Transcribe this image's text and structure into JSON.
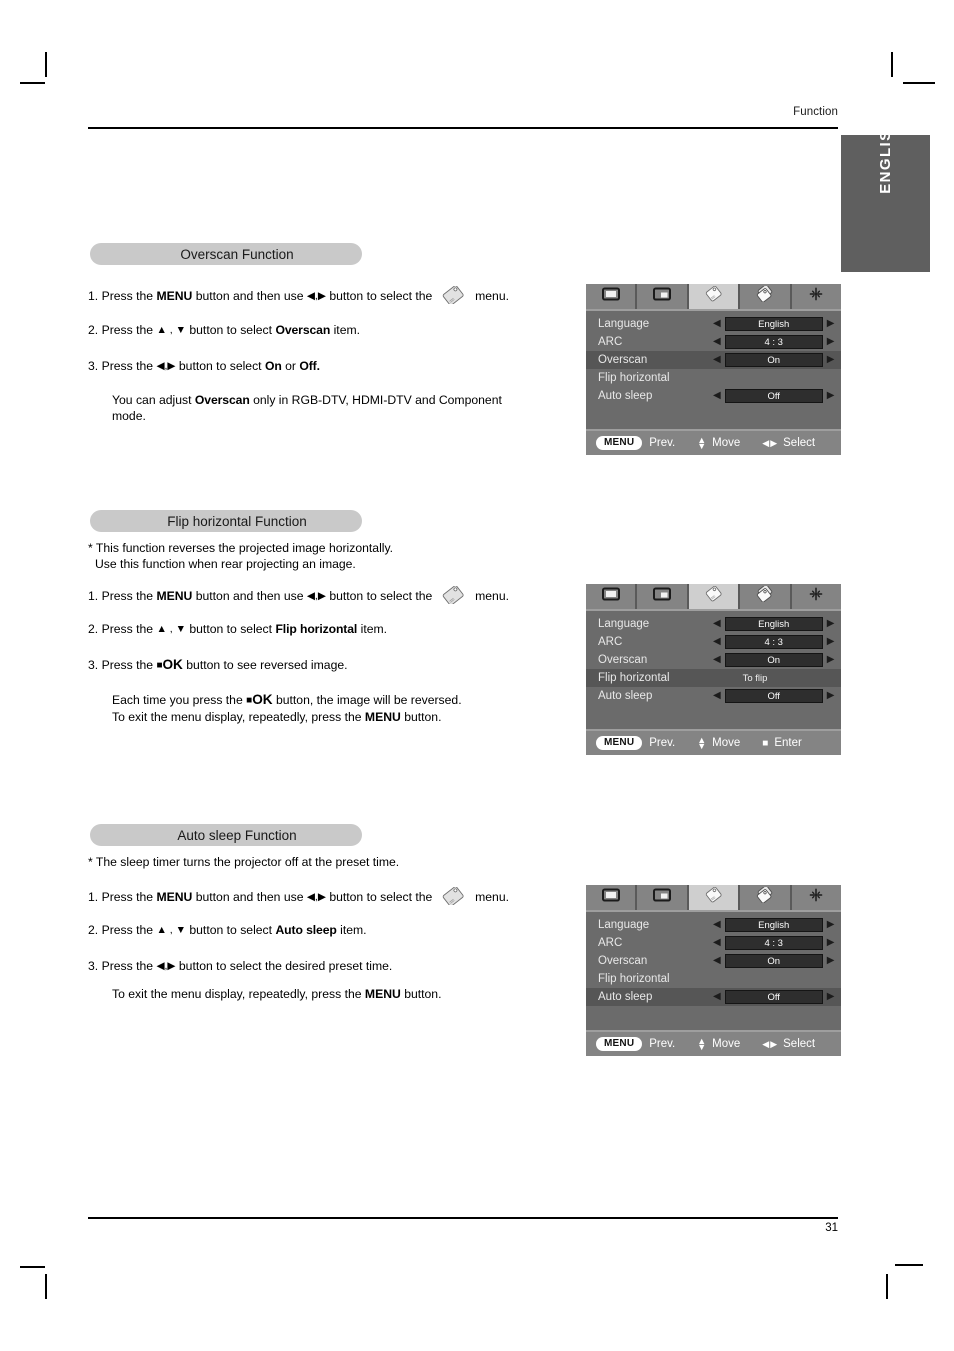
{
  "page": {
    "running_title": "Function",
    "language_tab": "ENGLISH",
    "page_number": "31"
  },
  "sections": [
    {
      "heading": "Overscan Function",
      "intro": [],
      "steps": [
        "1. Press the MENU button and then use ◀,▶ button to select the   menu.",
        "2. Press the ▲ , ▼ button to select Overscan item.",
        "3. Press the ◀,▶ button to select On or Off."
      ],
      "note": "You can adjust Overscan only in RGB-DTV, HDMI-DTV and Component mode."
    },
    {
      "heading": "Flip horizontal Function",
      "intro": [
        "* This function reverses the projected image horizontally.",
        "Use this function when rear projecting an image."
      ],
      "steps": [
        "1. Press the MENU button and then use ◀,▶ button to select the   menu.",
        "2. Press the ▲ , ▼ button to select Flip horizontal item.",
        "3. Press the ■OK button to see reversed image."
      ],
      "note": "Each time you press the ■OK button, the image will be reversed. To exit the menu display, repeatedly, press the MENU button."
    },
    {
      "heading": "Auto sleep Function",
      "intro": [
        "* The sleep timer turns the projector off at the preset time."
      ],
      "steps": [
        "1. Press the MENU button and then use ◀,▶ button to select the   menu.",
        "2. Press the ▲ , ▼ button to select Auto sleep item.",
        "3. Press the ◀,▶ button to select the desired preset time."
      ],
      "note": "To exit the menu display, repeatedly, press the MENU button."
    }
  ],
  "text": {
    "press_the": "Press the",
    "menu_bold": "MENU",
    "button_and_then_use": "button and then use",
    "button_to_select_the": "button to select the",
    "menu_word": "menu.",
    "button_to_select": "button to select",
    "item_word": "item.",
    "or_word": "or",
    "overscan_bold": "Overscan",
    "flip_horizontal_bold": "Flip horizontal",
    "auto_sleep_bold": "Auto sleep",
    "on_bold": "On",
    "off_bold": "Off.",
    "ok_bold": "OK",
    "num1": "1.",
    "num2": "2.",
    "num3": "3.",
    "left_right_arrows": "◀,▶",
    "up_down_arrows": "▲ , ▼",
    "square": "■",
    "note_overscan_a": "You can adjust",
    "note_overscan_b": "only in RGB-DTV, HDMI-DTV and Component",
    "note_overscan_c": "mode.",
    "flip_intro_1": "* This function reverses the projected image horizontally.",
    "flip_intro_2": "Use this function when rear projecting an image.",
    "flip_note_1a": "Each time you press the",
    "flip_note_1b": "button, the image will be reversed.",
    "flip_note_2a": "To exit the menu display, repeatedly, press the",
    "flip_note_2b": "button.",
    "flip_step3a": "button to see reversed image.",
    "sleep_intro_1": "* The sleep timer turns the projector off at the preset time.",
    "sleep_step3": "button to select the desired preset time.",
    "sleep_note_a": "To exit the menu display, repeatedly, press the",
    "sleep_note_b": "button."
  },
  "osd_panels": [
    {
      "id": "overscan",
      "tabs": [
        "screen-icon",
        "pip-icon",
        "tag-icon",
        "double-tag-icon",
        "adjust-icon"
      ],
      "active_tab_index": 2,
      "rows": [
        {
          "label": "Language",
          "value": "English",
          "type": "select",
          "selected": false
        },
        {
          "label": "ARC",
          "value": "4 : 3",
          "type": "select",
          "selected": false
        },
        {
          "label": "Overscan",
          "value": "On",
          "type": "select",
          "selected": true
        },
        {
          "label": "Flip horizontal",
          "value": "",
          "type": "none",
          "selected": false
        },
        {
          "label": "Auto sleep",
          "value": "Off",
          "type": "select",
          "selected": false
        }
      ],
      "footer": {
        "menu_chip": "MENU",
        "prev": "Prev.",
        "move": "Move",
        "action": "Select",
        "action_glyph": "◀▶"
      }
    },
    {
      "id": "flip-horizontal",
      "tabs": [
        "screen-icon",
        "pip-icon",
        "tag-icon",
        "double-tag-icon",
        "adjust-icon"
      ],
      "active_tab_index": 2,
      "rows": [
        {
          "label": "Language",
          "value": "English",
          "type": "select",
          "selected": false
        },
        {
          "label": "ARC",
          "value": "4 : 3",
          "type": "select",
          "selected": false
        },
        {
          "label": "Overscan",
          "value": "On",
          "type": "select",
          "selected": false
        },
        {
          "label": "Flip horizontal",
          "value": "To flip",
          "type": "note",
          "selected": true
        },
        {
          "label": "Auto sleep",
          "value": "Off",
          "type": "select",
          "selected": false
        }
      ],
      "footer": {
        "menu_chip": "MENU",
        "prev": "Prev.",
        "move": "Move",
        "action": "Enter",
        "action_glyph": "■"
      }
    },
    {
      "id": "auto-sleep",
      "tabs": [
        "screen-icon",
        "pip-icon",
        "tag-icon",
        "double-tag-icon",
        "adjust-icon"
      ],
      "active_tab_index": 2,
      "rows": [
        {
          "label": "Language",
          "value": "English",
          "type": "select",
          "selected": false
        },
        {
          "label": "ARC",
          "value": "4 : 3",
          "type": "select",
          "selected": false
        },
        {
          "label": "Overscan",
          "value": "On",
          "type": "select",
          "selected": false
        },
        {
          "label": "Flip horizontal",
          "value": "",
          "type": "none",
          "selected": false
        },
        {
          "label": "Auto sleep",
          "value": "Off",
          "type": "select",
          "selected": true
        }
      ],
      "footer": {
        "menu_chip": "MENU",
        "prev": "Prev.",
        "move": "Move",
        "action": "Select",
        "action_glyph": "◀▶"
      }
    }
  ],
  "colors": {
    "pill": "#c9c9c9",
    "tab_bg": "#5f5f5f",
    "osd_body": "#6b6b6b",
    "osd_bar": "#848484",
    "osd_selected_row": "#565656",
    "osd_value_box": "#2e2e2e"
  }
}
